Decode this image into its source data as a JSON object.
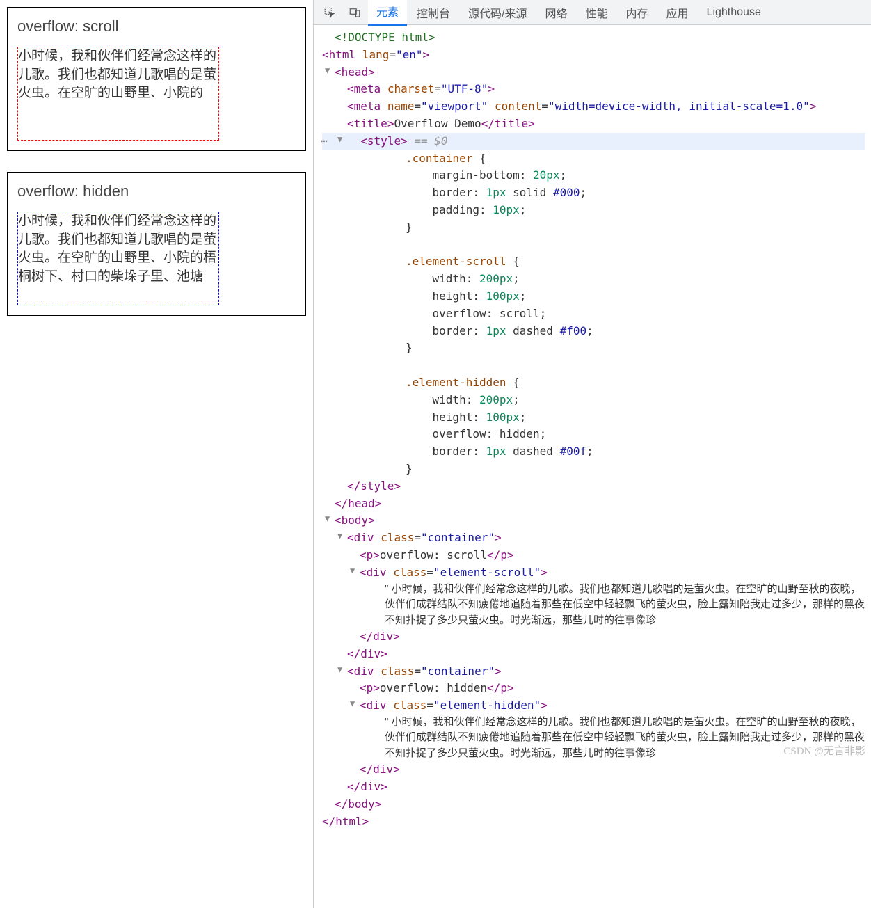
{
  "left": {
    "scroll_label": "overflow: scroll",
    "hidden_label": "overflow: hidden",
    "scroll_text": "小时候，我和伙伴们经常念这样的儿歌。我们也都知道儿歌唱的是萤火虫。在空旷的山野里、小院的",
    "hidden_text": "小时候，我和伙伴们经常念这样的儿歌。我们也都知道儿歌唱的是萤火虫。在空旷的山野里、小院的梧桐树下、村口的柴垛子里、池塘"
  },
  "tabs": {
    "elements": "元素",
    "console": "控制台",
    "sources": "源代码/来源",
    "network": "网络",
    "performance": "性能",
    "memory": "内存",
    "application": "应用",
    "lighthouse": "Lighthouse"
  },
  "dom": {
    "doctype": "<!DOCTYPE html>",
    "html_open": "html",
    "lang_attr": "lang",
    "lang_val": "\"en\"",
    "head": "head",
    "meta1_attr": "charset",
    "meta1_val": "\"UTF-8\"",
    "meta2_name": "name",
    "meta2_name_val": "\"viewport\"",
    "meta2_content": "content",
    "meta2_content_val": "\"width=device-width, initial-scale=1.0\"",
    "title_tag": "title",
    "title_text": "Overflow Demo",
    "style_tag": "style",
    "eq0": " == $0",
    "css": ".container {\n    margin-bottom: 20px;\n    border: 1px solid #000;\n    padding: 10px;\n}\n\n.element-scroll {\n    width: 200px;\n    height: 100px;\n    overflow: scroll;\n    border: 1px dashed #f00;\n}\n\n.element-hidden {\n    width: 200px;\n    height: 100px;\n    overflow: hidden;\n    border: 1px dashed #00f;\n}",
    "body": "body",
    "div": "div",
    "class_attr": "class",
    "container_val": "\"container\"",
    "p_tag": "p",
    "p1_text": "overflow: scroll",
    "p2_text": "overflow: hidden",
    "scroll_class": "\"element-scroll\"",
    "hidden_class": "\"element-hidden\"",
    "long_text": "\" 小时候，我和伙伴们经常念这样的儿歌。我们也都知道儿歌唱的是萤火虫。在空旷的山野至秋的夜晚，伙伴们成群结队不知疲倦地追随着那些在低空中轻轻飘飞的萤火虫，脸上露知陪我走过多少，那样的黑夜不知扑捉了多少只萤火虫。时光渐远，那些儿时的往事像珍"
  },
  "watermark": "CSDN @无言非影"
}
